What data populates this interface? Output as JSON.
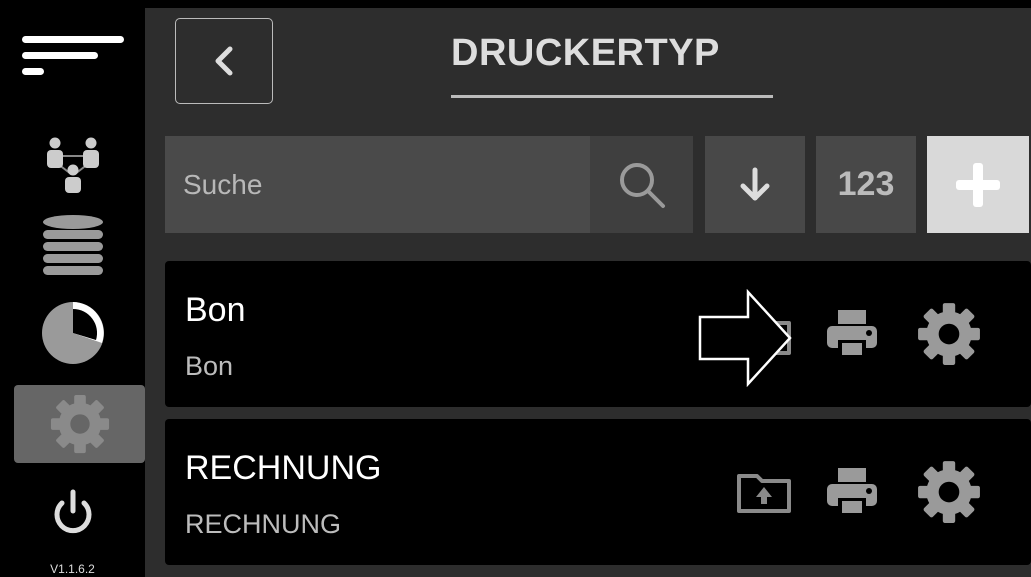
{
  "sidebar": {
    "items": [
      {
        "name": "menu",
        "icon": "hamburger-icon"
      },
      {
        "name": "users",
        "icon": "users-network-icon"
      },
      {
        "name": "database",
        "icon": "database-icon"
      },
      {
        "name": "statistics",
        "icon": "pie-chart-icon"
      },
      {
        "name": "settings",
        "icon": "gear-icon",
        "active": true
      },
      {
        "name": "power",
        "icon": "power-icon"
      }
    ],
    "version": "V1.1.6.2"
  },
  "header": {
    "title": "DRUCKERTYP",
    "back_icon": "chevron-left-icon"
  },
  "toolbar": {
    "search_placeholder": "Suche",
    "sort_icon": "arrow-down-icon",
    "numeric_label": "123",
    "add_icon": "plus-icon"
  },
  "list": [
    {
      "title": "Bon",
      "subtitle": "Bon",
      "actions": [
        "export-icon",
        "printer-icon",
        "gear-icon"
      ]
    },
    {
      "title": "RECHNUNG",
      "subtitle": "RECHNUNG",
      "actions": [
        "export-icon",
        "printer-icon",
        "gear-icon"
      ]
    }
  ],
  "colors": {
    "background": "#000000",
    "panel": "#2d2d2d",
    "input": "#4a4a4a",
    "add_button": "#d9d9d9",
    "icon": "#9a9a9a"
  }
}
